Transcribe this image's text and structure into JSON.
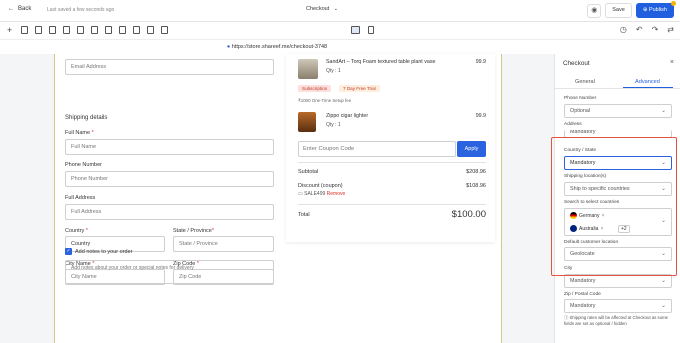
{
  "topbar": {
    "back_label": "Back",
    "saved_text": "Last saved a few seconds ago",
    "page_selector": "Checkout",
    "save_label": "Save",
    "publish_label": "Publish"
  },
  "url": "https://store.shareef.me/checkout-3748",
  "form": {
    "email_placeholder": "Email Address",
    "shipping_heading": "Shipping details",
    "full_name_label": "Full Name",
    "full_name_placeholder": "Full Name",
    "phone_label": "Phone Number",
    "phone_placeholder": "Phone Number",
    "address_label": "Full Address",
    "address_placeholder": "Full Address",
    "country_label": "Country",
    "country_value": "Country",
    "state_label": "State / Province",
    "state_placeholder": "State / Province",
    "city_label": "City Name",
    "city_placeholder": "City Name",
    "zip_label": "Zip Code",
    "zip_placeholder": "Zip Code",
    "notes_label": "Add notes to your order",
    "notes_placeholder": "Add notes about your order or special notes for delivery",
    "required_mark": "*"
  },
  "order": {
    "items": [
      {
        "name": "SandArt – Torq Foam textured table plant vase",
        "qty": "Qty : 1",
        "price": "99.9"
      },
      {
        "name": "Zippo cigar lighter",
        "qty": "Qty : 1",
        "price": "99.9"
      }
    ],
    "badge_subscription": "Subscription",
    "badge_trial": "7 Day Free Trial",
    "setup_fee": "₹1000 One-Time Setup fee",
    "coupon_placeholder": "Enter Coupon Code",
    "apply_label": "Apply",
    "subtotal_label": "Subtotal",
    "subtotal_value": "$208.96",
    "discount_label": "Discount (coupon)",
    "discount_value": "$108.96",
    "coupon_code": "SALE499",
    "remove_label": "Remove",
    "total_label": "Total",
    "total_value": "$100.00"
  },
  "panel": {
    "title": "Checkout",
    "tab_general": "General",
    "tab_advanced": "Advanced",
    "phone_label": "Phone Number",
    "phone_value": "Optional",
    "address_label": "Address",
    "address_value": "Mandatory",
    "country_label": "Country / State",
    "country_value": "Mandatory",
    "shipping_label": "Shipping location(s)",
    "shipping_value": "Ship to specific countries",
    "search_label": "Search to select countries",
    "chip_1": "Germany",
    "chip_2": "Australia",
    "chip_more": "+2",
    "default_loc_label": "Default customer location",
    "default_loc_value": "Geolocate",
    "city_label": "City",
    "city_value": "Mandatory",
    "zip_label": "Zip / Postal Code",
    "zip_value": "Mandatory",
    "note": "Shipping rates will be affected at Checkout as some fields are set as optional / hidden"
  },
  "colors": {
    "accent": "#1f5fe0",
    "highlight": "#e2553d",
    "badge_sub_bg": "#fde0dc",
    "badge_trial_bg": "#fdeede"
  }
}
